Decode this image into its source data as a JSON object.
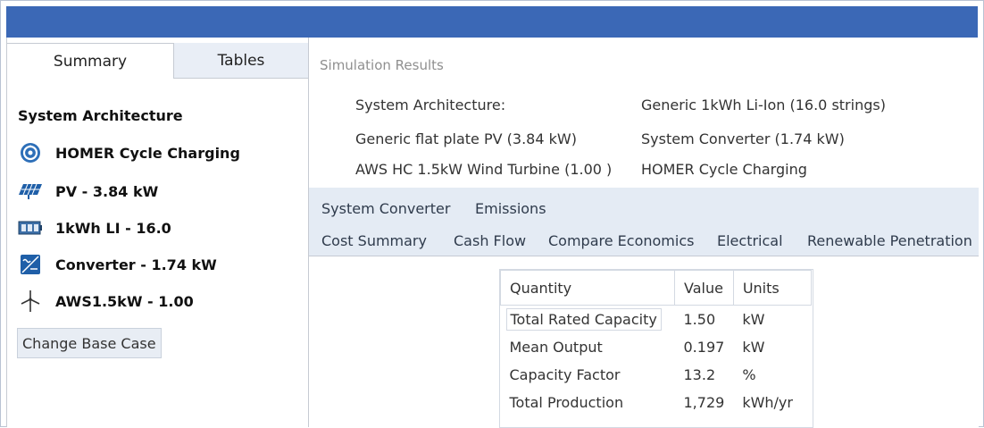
{
  "left_panel": {
    "tabs": [
      {
        "label": "Summary",
        "active": true
      },
      {
        "label": "Tables",
        "active": false
      }
    ],
    "section_title": "System Architecture",
    "components": [
      {
        "icon": "homer-dispatch-icon",
        "label": "HOMER Cycle Charging"
      },
      {
        "icon": "pv-panel-icon",
        "label": "PV - 3.84 kW"
      },
      {
        "icon": "battery-icon",
        "label": "1kWh LI - 16.0"
      },
      {
        "icon": "converter-icon",
        "label": "Converter - 1.74 kW"
      },
      {
        "icon": "wind-turbine-icon",
        "label": "AWS1.5kW - 1.00"
      }
    ],
    "change_base_case_label": "Change Base Case"
  },
  "right_panel": {
    "header": "Simulation Results",
    "architecture_label": "System Architecture:",
    "architecture_items": [
      "Generic 1kWh Li-Ion (16.0 strings)",
      "Generic flat plate PV (3.84 kW)",
      "System Converter (1.74 kW)",
      "AWS HC 1.5kW Wind Turbine (1.00 )",
      "HOMER Cycle Charging"
    ],
    "tabs_row1": [
      "System Converter",
      "Emissions"
    ],
    "tabs_row2": [
      "Cost Summary",
      "Cash Flow",
      "Compare Economics",
      "Electrical",
      "Renewable Penetration"
    ],
    "table": {
      "headers": [
        "Quantity",
        "Value",
        "Units"
      ],
      "rows": [
        [
          "Total Rated Capacity",
          "1.50",
          "kW"
        ],
        [
          "Mean Output",
          "0.197",
          "kW"
        ],
        [
          "Capacity Factor",
          "13.2",
          "%"
        ],
        [
          "Total Production",
          "1,729",
          "kWh/yr"
        ]
      ]
    }
  },
  "colors": {
    "titlebar": "#3b68b6",
    "tabstrip": "#e4ebf4",
    "border": "#c6cbd3"
  }
}
